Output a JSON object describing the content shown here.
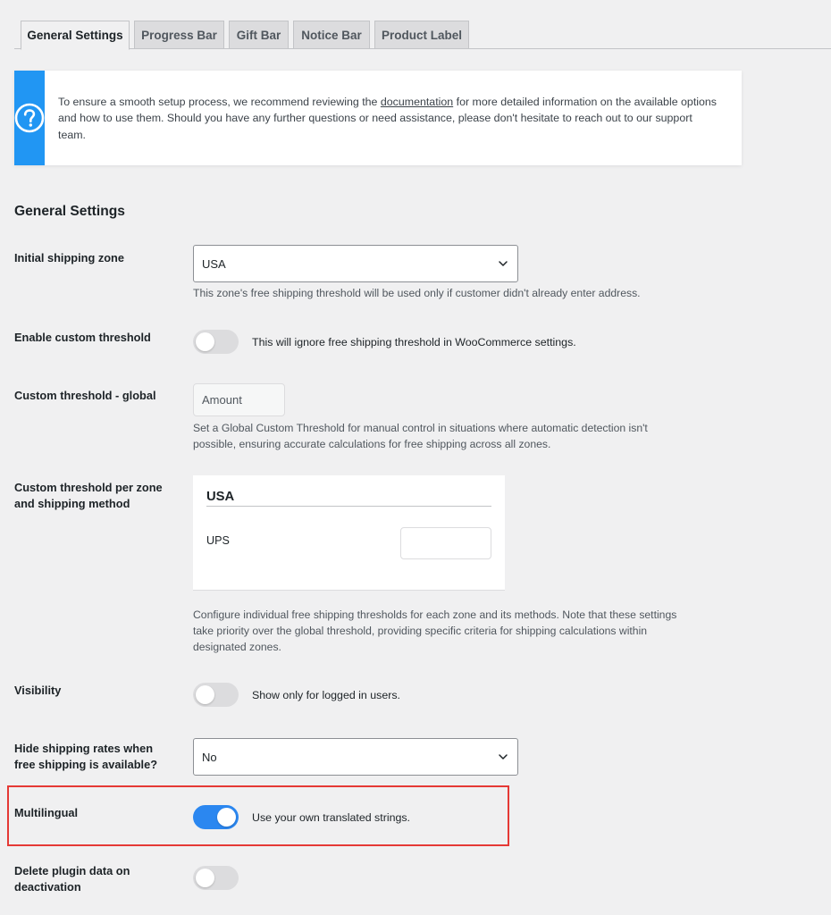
{
  "tabs": [
    {
      "label": "General Settings",
      "active": true
    },
    {
      "label": "Progress Bar",
      "active": false
    },
    {
      "label": "Gift Bar",
      "active": false
    },
    {
      "label": "Notice Bar",
      "active": false
    },
    {
      "label": "Product Label",
      "active": false
    }
  ],
  "notice": {
    "icon": "question-circle-icon",
    "text_before": "To ensure a smooth setup process, we recommend reviewing the ",
    "link_text": "documentation",
    "text_after": " for more detailed information on the available options and how to use them. Should you have any further questions or need assistance, please don't hesitate to reach out to our support team.",
    "accent_color": "#2196f3"
  },
  "section_title": "General Settings",
  "initial_zone": {
    "label": "Initial shipping zone",
    "value": "USA",
    "description": "This zone's free shipping threshold will be used only if customer didn't already enter address."
  },
  "custom_threshold": {
    "label": "Enable custom threshold",
    "enabled": false,
    "text": "This will ignore free shipping threshold in WooCommerce settings."
  },
  "global_threshold": {
    "label": "Custom threshold - global",
    "placeholder": "Amount",
    "description": "Set a Global Custom Threshold for manual control in situations where automatic detection isn't possible, ensuring accurate calculations for free shipping across all zones."
  },
  "per_zone": {
    "label": "Custom threshold per zone and shipping method",
    "zone_name": "USA",
    "method_name": "UPS",
    "description": "Configure individual free shipping thresholds for each zone and its methods. Note that these settings take priority over the global threshold, providing specific criteria for shipping calculations within designated zones."
  },
  "visibility": {
    "label": "Visibility",
    "enabled": false,
    "text": "Show only for logged in users."
  },
  "hide_rates": {
    "label": "Hide shipping rates when free shipping is available?",
    "value": "No"
  },
  "multilingual": {
    "label": "Multilingual",
    "enabled": true,
    "text": "Use your own translated strings.",
    "toggle_color": "#2b87f0",
    "highlight_color": "#e53935"
  },
  "delete_data": {
    "label": "Delete plugin data on deactivation",
    "enabled": false
  }
}
